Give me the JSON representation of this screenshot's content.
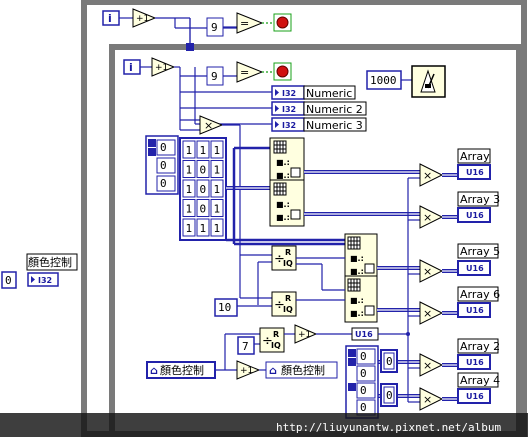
{
  "outer_loop": {
    "index_label": "i",
    "compare_const": "9",
    "increment_label": "+1",
    "equal_label": "="
  },
  "inner_loop": {
    "index_label": "i",
    "compare_const": "9",
    "increment_label": "+1",
    "equal_label": "=",
    "wait_const": "1000",
    "indicators": [
      "Numeric",
      "Numeric 2",
      "Numeric 3"
    ],
    "i32_tag": "I32",
    "multiply_label": "×",
    "matrix_const": [
      [
        "1",
        "1",
        "1"
      ],
      [
        "1",
        "0",
        "1"
      ],
      [
        "1",
        "0",
        "1"
      ],
      [
        "1",
        "0",
        "1"
      ],
      [
        "1",
        "1",
        "1"
      ]
    ],
    "index_const": [
      "0",
      "0",
      "0"
    ],
    "array_indicators": [
      "Array",
      "Array 3",
      "Array 5",
      "Array 6",
      "Array 2",
      "Array 4"
    ],
    "u16_tag": "U16",
    "quotient_label": "R\nIQ",
    "quotient_const": "10",
    "seven_const": "7",
    "u16_convert": "U16",
    "color_local_read": "顏色控制",
    "color_local_write": "顏色控制",
    "plus1_label": "+1",
    "bottom_consts": [
      "0",
      "0",
      "0",
      "0",
      "0",
      "0"
    ],
    "bottom_index": [
      "0",
      "0"
    ]
  },
  "left_control": {
    "label": "顏色控制",
    "value": "0",
    "tag": "I32"
  },
  "watermark": "http://liuyunantw.pixnet.net/album",
  "colors": {
    "wire_blue": "#2222aa",
    "frame_gray": "#7a7a7a",
    "cream": "#ffffe0",
    "boolean_red": "#d01010",
    "boolean_green": "#18a018"
  }
}
